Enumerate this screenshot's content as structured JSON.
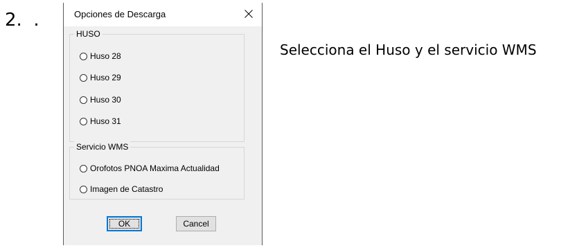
{
  "step": {
    "number": "2.",
    "marker": "."
  },
  "instruction": "Selecciona el Huso y el servicio WMS",
  "dialog": {
    "title": "Opciones de Descarga",
    "close_icon": "close-icon",
    "groups": {
      "huso": {
        "label": "HUSO",
        "options": [
          "Huso 28",
          "Huso 29",
          "Huso 30",
          "Huso 31"
        ]
      },
      "wms": {
        "label": "Servicio WMS",
        "options": [
          "Orofotos PNOA Maxima Actualidad",
          "Imagen de Catastro"
        ]
      }
    },
    "buttons": {
      "ok": "OK",
      "cancel": "Cancel"
    }
  },
  "colors": {
    "dialog_bg": "#f0f0f0",
    "titlebar_bg": "#ffffff",
    "focus_border": "#0078d7",
    "button_bg": "#e1e1e1"
  }
}
